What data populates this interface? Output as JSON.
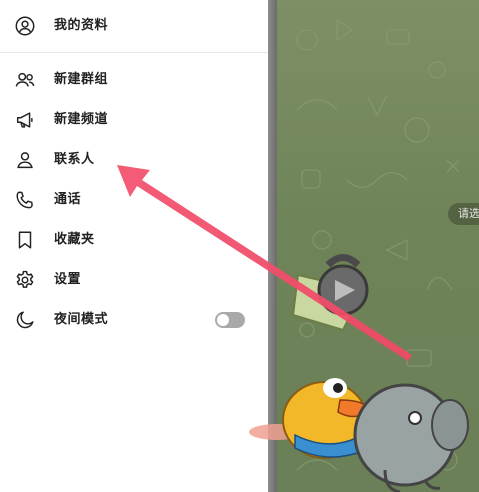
{
  "menu": {
    "profile_label": "我的资料",
    "items": [
      {
        "label": "新建群组",
        "icon": "group-icon"
      },
      {
        "label": "新建频道",
        "icon": "megaphone-icon"
      },
      {
        "label": "联系人",
        "icon": "person-icon"
      },
      {
        "label": "通话",
        "icon": "phone-icon"
      },
      {
        "label": "收藏夹",
        "icon": "bookmark-icon"
      },
      {
        "label": "设置",
        "icon": "gear-icon"
      },
      {
        "label": "夜间模式",
        "icon": "moon-icon"
      }
    ],
    "night_mode_on": false
  },
  "chat": {
    "pill_text": "请选"
  },
  "colors": {
    "arrow": "#f0506e",
    "chat_background": "#738659",
    "toggle_off": "#a9a9a9"
  }
}
